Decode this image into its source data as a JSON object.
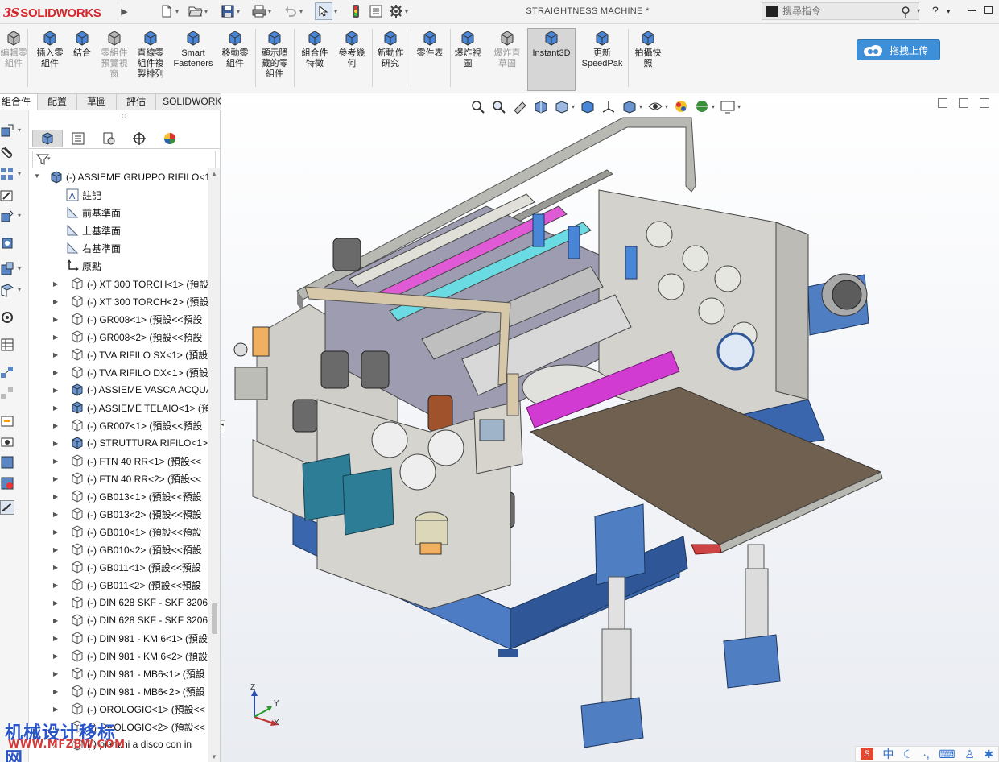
{
  "app": {
    "brand_ds": "3S",
    "brand_name": "SOLIDWORKS",
    "document_title": "STRAIGHTNESS MACHINE *"
  },
  "search": {
    "placeholder": "搜尋指令"
  },
  "titlebar_right": {
    "help": "?",
    "help_drop": "▾"
  },
  "commands": [
    {
      "label": "編輯零\n組件",
      "icon": "edit-component-icon",
      "dim": true
    },
    {
      "label": "插入零\n組件",
      "icon": "insert-component-icon",
      "dim": false
    },
    {
      "label": "結合",
      "icon": "mate-icon",
      "dim": false
    },
    {
      "label": "零組件\n預覽視\n窗",
      "icon": "component-preview-icon",
      "dim": true
    },
    {
      "label": "直線零\n組件複\n製排列",
      "icon": "linear-pattern-icon",
      "dim": false
    },
    {
      "label": "Smart\nFasteners",
      "icon": "smart-fasteners-icon",
      "dim": false
    },
    {
      "label": "移動零\n組件",
      "icon": "move-component-icon",
      "dim": false
    },
    {
      "label": "顯示隱\n藏的零\n組件",
      "icon": "show-hidden-icon",
      "dim": false
    },
    {
      "label": "組合件\n特徵",
      "icon": "assembly-features-icon",
      "dim": false
    },
    {
      "label": "參考幾\n何",
      "icon": "reference-geometry-icon",
      "dim": false
    },
    {
      "label": "新動作\n研究",
      "icon": "motion-study-icon",
      "dim": false
    },
    {
      "label": "零件表",
      "icon": "bom-icon",
      "dim": false
    },
    {
      "label": "爆炸視\n圖",
      "icon": "exploded-view-icon",
      "dim": false
    },
    {
      "label": "爆炸直\n草圖",
      "icon": "explode-line-sketch-icon",
      "dim": true
    },
    {
      "label": "Instant3D",
      "icon": "instant3d-icon",
      "dim": false
    },
    {
      "label": "更新\nSpeedPak",
      "icon": "speedpak-icon",
      "dim": false
    },
    {
      "label": "拍攝快\n照",
      "icon": "snapshot-icon",
      "dim": false
    }
  ],
  "upload_button": {
    "label": "拖拽上传"
  },
  "tabs": [
    "組合件",
    "配置",
    "草圖",
    "評估",
    "SOLIDWORKS MBD"
  ],
  "feature_tree": {
    "root": "(-) ASSIEME GRUPPO RIFILO<1",
    "items": [
      {
        "label": "註記",
        "icon": "annotations-icon",
        "indent": 1,
        "expandable": false
      },
      {
        "label": "前基準面",
        "icon": "plane-icon",
        "indent": 1,
        "expandable": false
      },
      {
        "label": "上基準面",
        "icon": "plane-icon",
        "indent": 1,
        "expandable": false
      },
      {
        "label": "右基準面",
        "icon": "plane-icon",
        "indent": 1,
        "expandable": false
      },
      {
        "label": "原點",
        "icon": "origin-icon",
        "indent": 1,
        "expandable": false
      },
      {
        "label": "(-) XT 300 TORCH<1> (預設",
        "icon": "part-icon",
        "indent": 1,
        "expandable": true
      },
      {
        "label": "(-) XT 300 TORCH<2> (預設",
        "icon": "part-icon",
        "indent": 1,
        "expandable": true
      },
      {
        "label": "(-) GR008<1> (預設<<預設",
        "icon": "part-icon",
        "indent": 1,
        "expandable": true
      },
      {
        "label": "(-) GR008<2> (預設<<預設",
        "icon": "part-icon",
        "indent": 1,
        "expandable": true
      },
      {
        "label": "(-) TVA RIFILO SX<1> (預設",
        "icon": "part-icon",
        "indent": 1,
        "expandable": true
      },
      {
        "label": "(-) TVA RIFILO DX<1> (預設",
        "icon": "part-icon",
        "indent": 1,
        "expandable": true
      },
      {
        "label": "(-) ASSIEME VASCA ACQUA",
        "icon": "assembly-icon",
        "indent": 1,
        "expandable": true
      },
      {
        "label": "(-) ASSIEME TELAIO<1> (預",
        "icon": "assembly-icon",
        "indent": 1,
        "expandable": true
      },
      {
        "label": "(-) GR007<1> (預設<<預設",
        "icon": "part-icon",
        "indent": 1,
        "expandable": true
      },
      {
        "label": "(-) STRUTTURA RIFILO<1>",
        "icon": "assembly-icon",
        "indent": 1,
        "expandable": true
      },
      {
        "label": "(-) FTN 40 RR<1> (預設<<",
        "icon": "part-icon",
        "indent": 1,
        "expandable": true
      },
      {
        "label": "(-) FTN 40 RR<2> (預設<<",
        "icon": "part-icon",
        "indent": 1,
        "expandable": true
      },
      {
        "label": "(-) GB013<1> (預設<<預設",
        "icon": "part-icon",
        "indent": 1,
        "expandable": true
      },
      {
        "label": "(-) GB013<2> (預設<<預設",
        "icon": "part-icon",
        "indent": 1,
        "expandable": true
      },
      {
        "label": "(-) GB010<1> (預設<<預設",
        "icon": "part-icon",
        "indent": 1,
        "expandable": true
      },
      {
        "label": "(-) GB010<2> (預設<<預設",
        "icon": "part-icon",
        "indent": 1,
        "expandable": true
      },
      {
        "label": "(-) GB011<1> (預設<<預設",
        "icon": "part-icon",
        "indent": 1,
        "expandable": true
      },
      {
        "label": "(-) GB011<2> (預設<<預設",
        "icon": "part-icon",
        "indent": 1,
        "expandable": true
      },
      {
        "label": "(-) DIN 628 SKF - SKF 3206",
        "icon": "part-icon",
        "indent": 1,
        "expandable": true
      },
      {
        "label": "(-) DIN 628 SKF - SKF 3206",
        "icon": "part-icon",
        "indent": 1,
        "expandable": true
      },
      {
        "label": "(-) DIN 981 - KM 6<1> (預設",
        "icon": "part-icon",
        "indent": 1,
        "expandable": true
      },
      {
        "label": "(-) DIN 981 - KM 6<2> (預設",
        "icon": "part-icon",
        "indent": 1,
        "expandable": true
      },
      {
        "label": "(-) DIN 981 - MB6<1> (預設",
        "icon": "part-icon",
        "indent": 1,
        "expandable": true
      },
      {
        "label": "(-) DIN 981 - MB6<2> (預設",
        "icon": "part-icon",
        "indent": 1,
        "expandable": true
      },
      {
        "label": "(-) OROLOGIO<1> (預設<<",
        "icon": "part-icon",
        "indent": 1,
        "expandable": true
      },
      {
        "label": "(-) OROLOGIO<2> (預設<<",
        "icon": "part-icon",
        "indent": 1,
        "expandable": true
      },
      {
        "label": "(-) piantini a disco con in",
        "icon": "part-icon",
        "indent": 1,
        "expandable": true
      }
    ]
  },
  "triad": {
    "z": "Z",
    "y": "Y",
    "x": "X"
  },
  "watermark": {
    "line1": "机械设计移标网",
    "line2": "WWW.MFZBW.COM"
  },
  "ime": {
    "mode": "中"
  },
  "colors": {
    "frame_blue": "#3f6db7",
    "panel_gray": "#c9c8c2",
    "accent_magenta": "#d02bd0",
    "brand_red": "#d7262b"
  }
}
